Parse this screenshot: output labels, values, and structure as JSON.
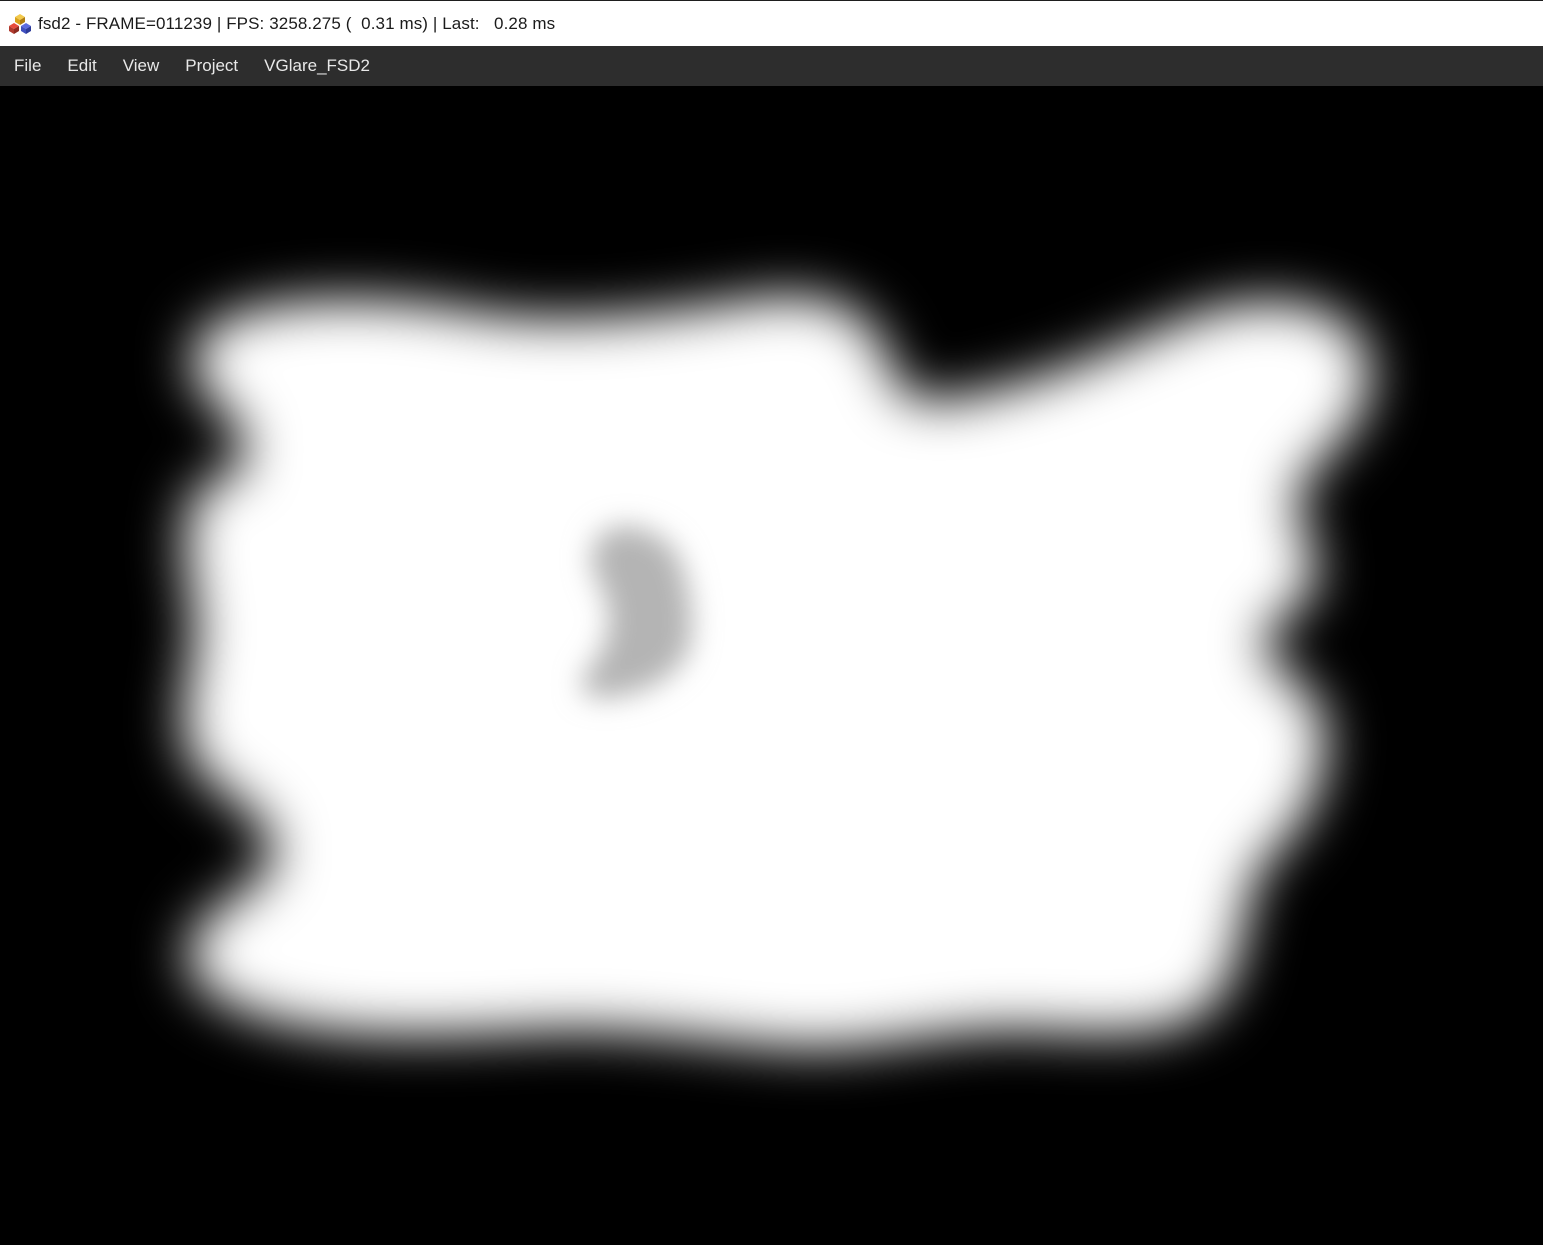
{
  "window": {
    "title": "fsd2 - FRAME=011239 | FPS: 3258.275 (  0.31 ms) | Last:   0.28 ms",
    "app_icon": "cube-stack-icon"
  },
  "menubar": {
    "items": [
      {
        "label": "File"
      },
      {
        "label": "Edit"
      },
      {
        "label": "View"
      },
      {
        "label": "Project"
      },
      {
        "label": "VGlare_FSD2"
      }
    ]
  },
  "viewport": {
    "background_color": "#000000",
    "glow_color": "#ffffff",
    "hole_color": "#b4b4b4"
  }
}
